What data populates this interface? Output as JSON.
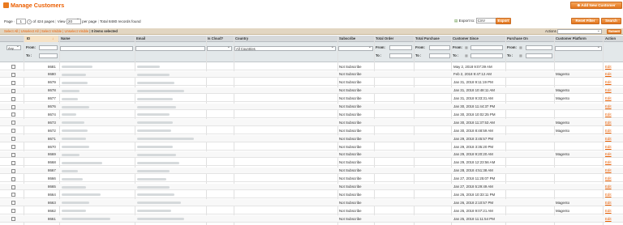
{
  "header": {
    "title": "Manage Customers",
    "add_button": "Add New Customer"
  },
  "pager": {
    "page_label": "Page",
    "page_value": "1",
    "of_pages": "of 424 pages",
    "view_label": "View",
    "per_page_value": "20",
    "per_page_label": "per page",
    "total": "Total 8480 records found"
  },
  "export": {
    "label": "Export to:",
    "format": "CSV",
    "button": "Export"
  },
  "toolbar": {
    "reset_filter": "Reset Filter",
    "search": "Search"
  },
  "massaction": {
    "select_all": "Select All",
    "unselect_all": "Unselect All",
    "select_visible": "Select Visible",
    "unselect_visible": "Unselect Visible",
    "selected": "0 items selected",
    "actions_label": "Actions",
    "submit": "Submit"
  },
  "columns": {
    "id": "ID",
    "name": "Name",
    "email": "Email",
    "is_cloud": "Is Cloud?",
    "country": "Country",
    "subscribe": "Subscribe",
    "total_order": "Total Order",
    "total_purchase": "Total Purchase",
    "customer_since": "Customer Since",
    "purchase_on": "Purchase On",
    "platform": "Customer Platform",
    "action": "Action"
  },
  "filters": {
    "any": "Any",
    "from": "From:",
    "to": "To :",
    "country": "All Countries"
  },
  "rows": [
    {
      "id": "8681",
      "subscribe": "Not Subscribe",
      "since": "May 2, 2018 9:07:39 AM",
      "platform": "",
      "action": "Edit"
    },
    {
      "id": "8680",
      "subscribe": "Not Subscribe",
      "since": "Feb 2, 2018 9:47:12 AM",
      "platform": "Magento",
      "action": "Edit"
    },
    {
      "id": "8679",
      "subscribe": "Not Subscribe",
      "since": "Jan 31, 2018 9:11:19 PM",
      "platform": "",
      "action": "Edit"
    },
    {
      "id": "8678",
      "subscribe": "Not Subscribe",
      "since": "Jan 31, 2018 10:48:11 AM",
      "platform": "Magento",
      "action": "Edit"
    },
    {
      "id": "8677",
      "subscribe": "Not Subscribe",
      "since": "Jan 31, 2018 9:33:31 AM",
      "platform": "Magento",
      "action": "Edit"
    },
    {
      "id": "8676",
      "subscribe": "Not Subscribe",
      "since": "Jan 30, 2018 11:44:37 PM",
      "platform": "",
      "action": "Edit"
    },
    {
      "id": "8674",
      "subscribe": "Not Subscribe",
      "since": "Jan 30, 2018 10:02:25 PM",
      "platform": "",
      "action": "Edit"
    },
    {
      "id": "8673",
      "subscribe": "Not Subscribe",
      "since": "Jan 30, 2018 11:37:53 AM",
      "platform": "Magento",
      "action": "Edit"
    },
    {
      "id": "8672",
      "subscribe": "Not Subscribe",
      "since": "Jan 30, 2018 8:48:59 AM",
      "platform": "Magento",
      "action": "Edit"
    },
    {
      "id": "8671",
      "subscribe": "Not Subscribe",
      "since": "Jan 29, 2018 3:45:57 PM",
      "platform": "",
      "action": "Edit"
    },
    {
      "id": "8670",
      "subscribe": "Not Subscribe",
      "since": "Jan 29, 2018 3:35:20 PM",
      "platform": "",
      "action": "Edit"
    },
    {
      "id": "8669",
      "subscribe": "Not Subscribe",
      "since": "Jan 29, 2018 9:20:20 AM",
      "platform": "Magento",
      "action": "Edit"
    },
    {
      "id": "8668",
      "subscribe": "Not Subscribe",
      "since": "Jan 29, 2018 12:23:56 AM",
      "platform": "",
      "action": "Edit"
    },
    {
      "id": "8667",
      "subscribe": "Not Subscribe",
      "since": "Jan 28, 2018 4:51:38 AM",
      "platform": "",
      "action": "Edit"
    },
    {
      "id": "8666",
      "subscribe": "Not Subscribe",
      "since": "Jan 27, 2018 11:25:07 PM",
      "platform": "",
      "action": "Edit"
    },
    {
      "id": "8665",
      "subscribe": "Not Subscribe",
      "since": "Jan 27, 2018 5:29:49 AM",
      "platform": "",
      "action": "Edit"
    },
    {
      "id": "8664",
      "subscribe": "Not Subscribe",
      "since": "Jan 26, 2018 10:33:11 PM",
      "platform": "",
      "action": "Edit"
    },
    {
      "id": "8663",
      "subscribe": "Not Subscribe",
      "since": "Jan 26, 2018 2:10:57 PM",
      "platform": "Magento",
      "action": "Edit"
    },
    {
      "id": "8662",
      "subscribe": "Not Subscribe",
      "since": "Jan 26, 2018 9:07:21 AM",
      "platform": "Magento",
      "action": "Edit"
    },
    {
      "id": "8661",
      "subscribe": "Not Subscribe",
      "since": "Jan 25, 2018 11:11:54 PM",
      "platform": "",
      "action": "Edit"
    }
  ]
}
